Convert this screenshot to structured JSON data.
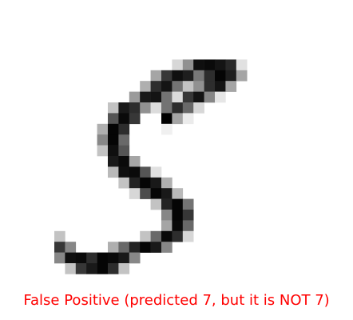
{
  "image": {
    "subject": "handwritten-digit",
    "style": "grayscale-pixel-grid",
    "colors": {
      "background": "#ffffff",
      "ink": "#000000"
    }
  },
  "caption": {
    "text": "False Positive (predicted 7, but it is NOT 7)",
    "color": "#ff0000"
  }
}
